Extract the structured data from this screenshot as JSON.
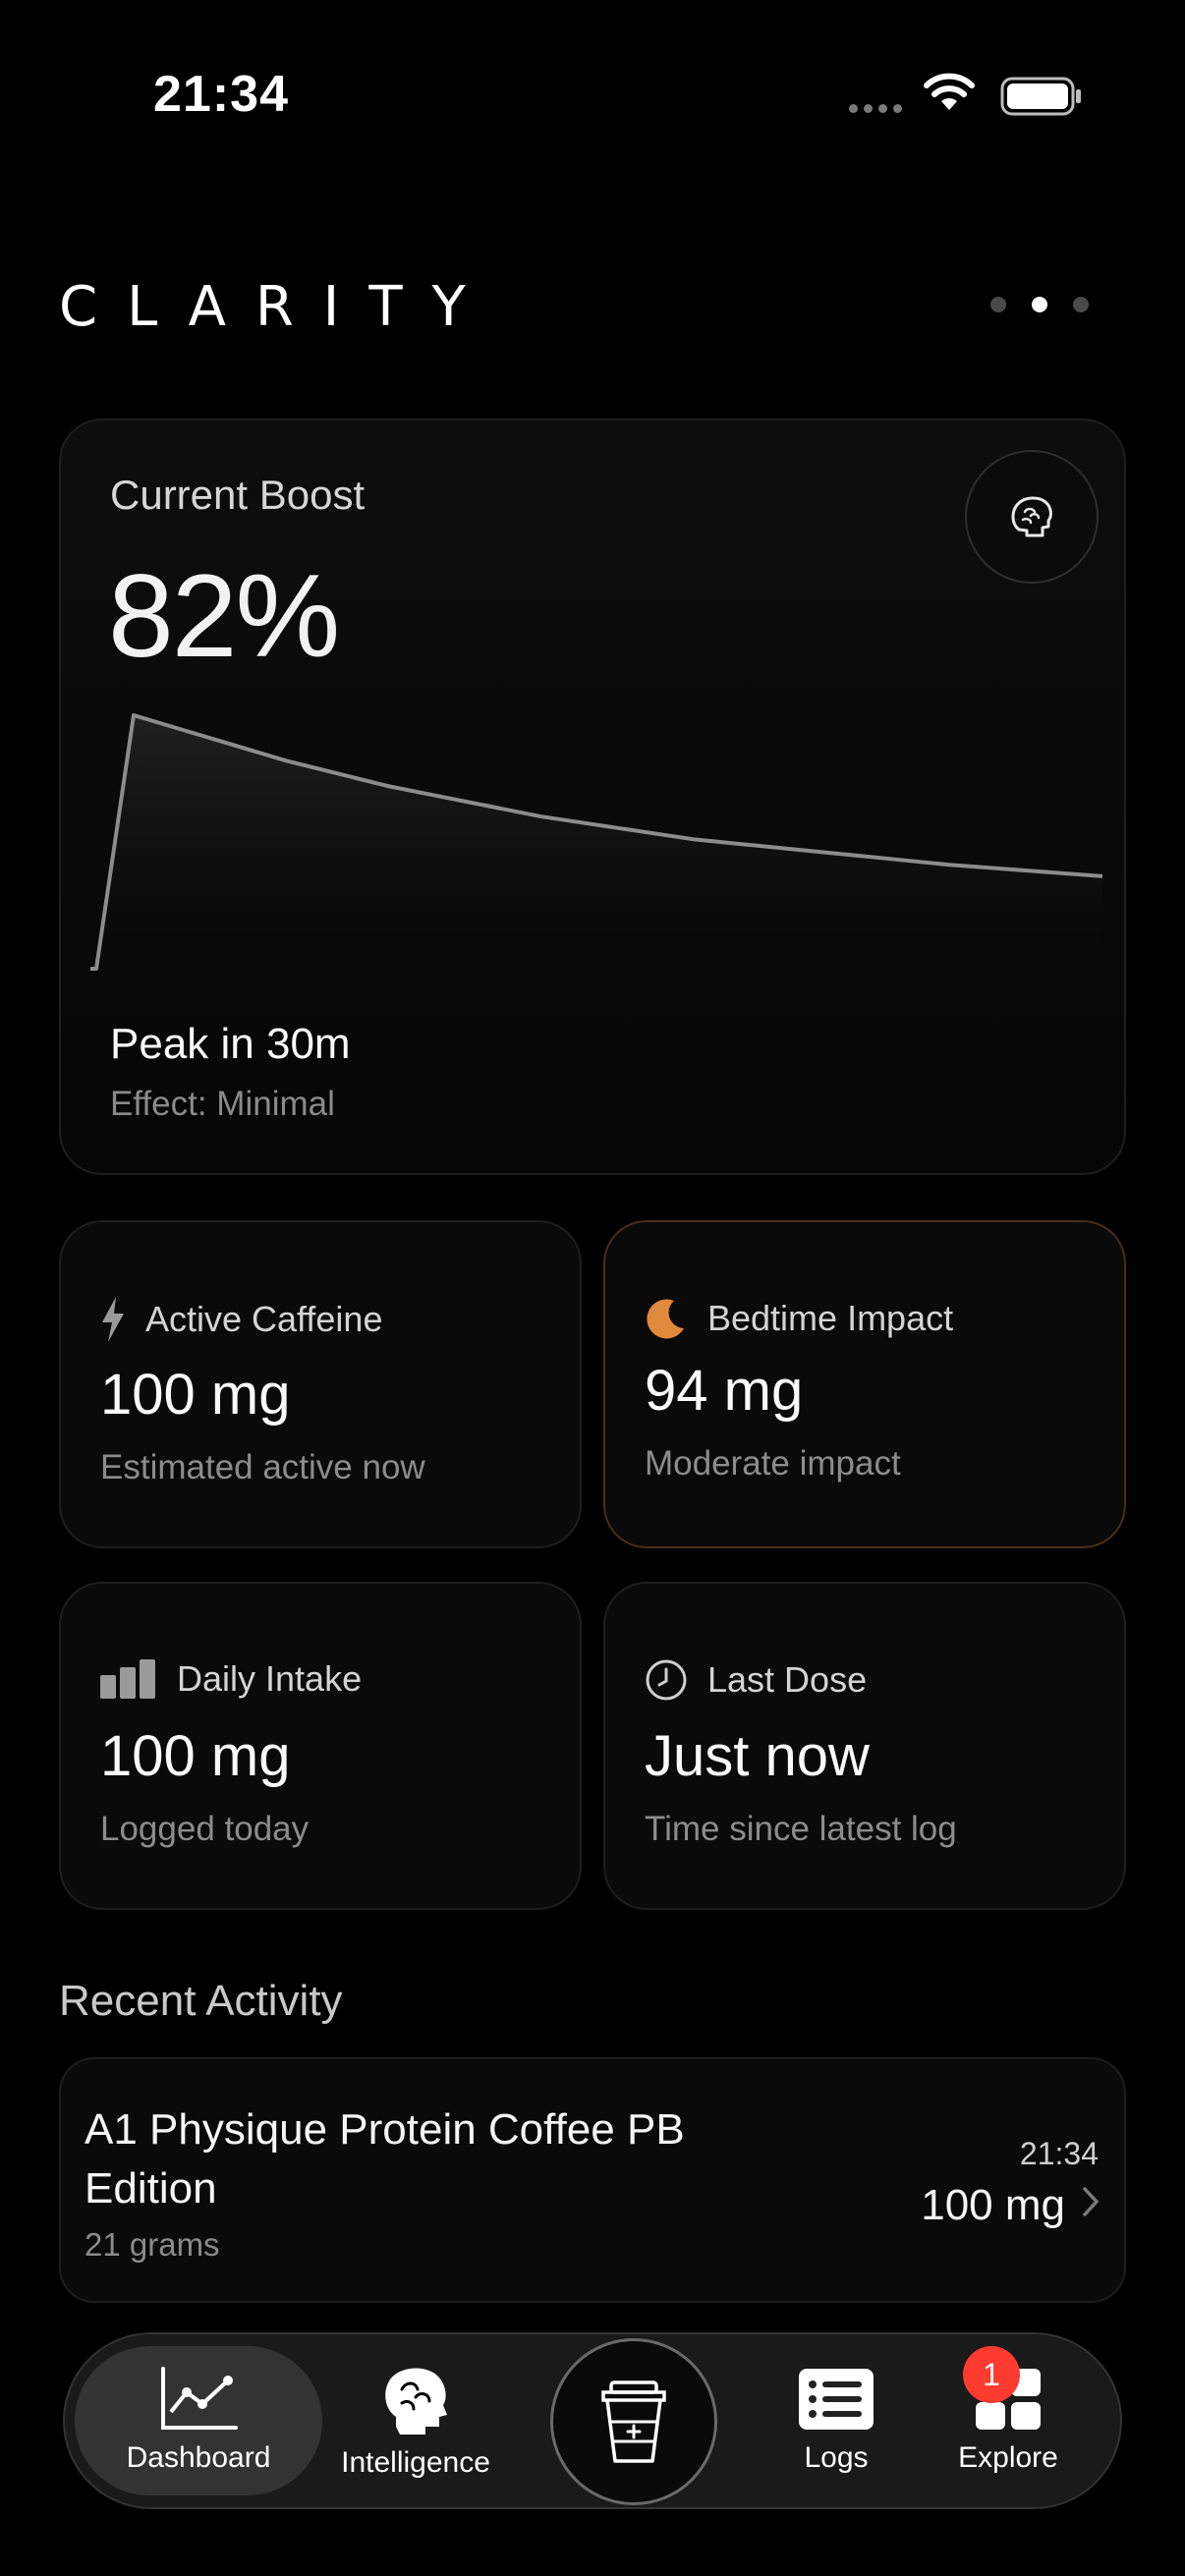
{
  "status_bar": {
    "time": "21:34"
  },
  "header": {
    "brand": "CLARITY",
    "pager_count": 3,
    "pager_active": 1
  },
  "boost": {
    "label": "Current Boost",
    "value": "82%",
    "peak_text": "Peak in 30m",
    "effect_text": "Effect: Minimal",
    "icon": "brain-icon"
  },
  "chart_data": {
    "type": "area",
    "title": "",
    "xlabel": "",
    "ylabel": "",
    "series": [
      {
        "values": [
          0,
          100,
          94,
          88,
          82,
          77,
          72,
          68,
          64,
          60,
          57,
          54,
          51,
          49,
          47,
          45,
          43,
          41,
          39.5,
          38,
          36.5
        ]
      }
    ],
    "grid": false,
    "line_color": "#8c8c8c"
  },
  "stats": {
    "active": {
      "label": "Active Caffeine",
      "value": "100 mg",
      "sub": "Estimated active now",
      "icon": "bolt-icon"
    },
    "bedtime": {
      "label": "Bedtime Impact",
      "value": "94 mg",
      "sub": "Moderate impact",
      "icon": "moon-icon",
      "accent": "#e08a3c"
    },
    "daily": {
      "label": "Daily Intake",
      "value": "100 mg",
      "sub": "Logged today",
      "icon": "bars-icon"
    },
    "last": {
      "label": "Last Dose",
      "value": "Just now",
      "sub": "Time since latest log",
      "icon": "clock-icon"
    }
  },
  "recent": {
    "title": "Recent Activity",
    "items": [
      {
        "name": "A1 Physique Protein Coffee PB Edition",
        "size": "21 grams",
        "time": "21:34",
        "amount": "100 mg"
      }
    ]
  },
  "tabs": {
    "dashboard": "Dashboard",
    "intelligence": "Intelligence",
    "logs": "Logs",
    "explore": "Explore",
    "explore_badge": "1"
  }
}
